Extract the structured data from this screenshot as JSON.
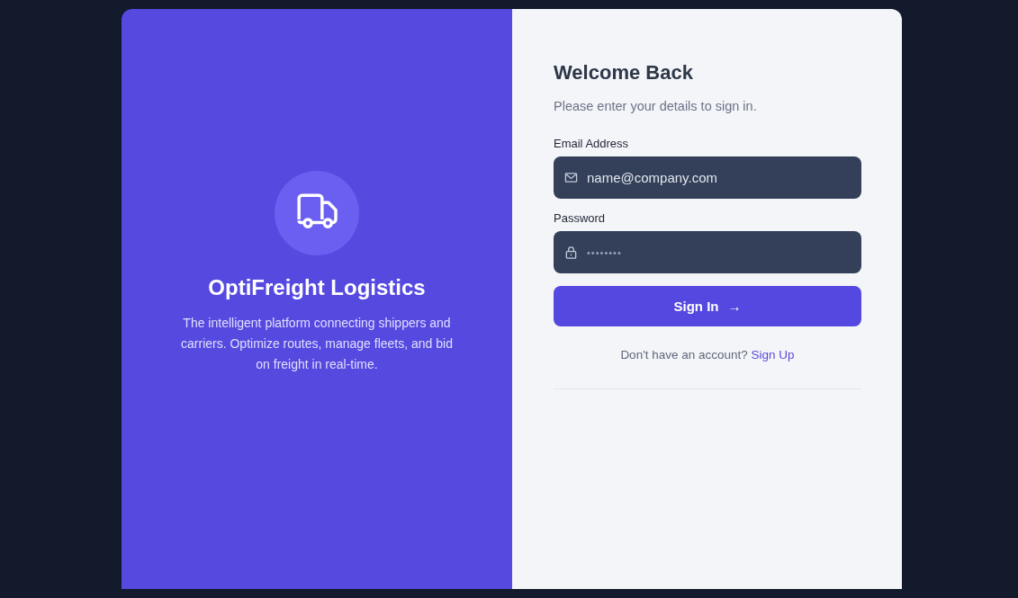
{
  "brand": {
    "title": "OptiFreight Logistics",
    "description": "The intelligent platform connecting shippers and carriers. Optimize routes, manage fleets, and bid on freight in real-time."
  },
  "form": {
    "title": "Welcome Back",
    "subtitle": "Please enter your details to sign in.",
    "fields": [
      {
        "kind": "email",
        "label": "Email Address",
        "placeholder": "name@company.com"
      },
      {
        "kind": "password",
        "label": "Password",
        "placeholder": "••••••••"
      }
    ],
    "submit": {
      "label": "Sign In",
      "icon": "→"
    },
    "signup": {
      "prompt": "Don't have an account?",
      "link": "Sign Up"
    }
  }
}
